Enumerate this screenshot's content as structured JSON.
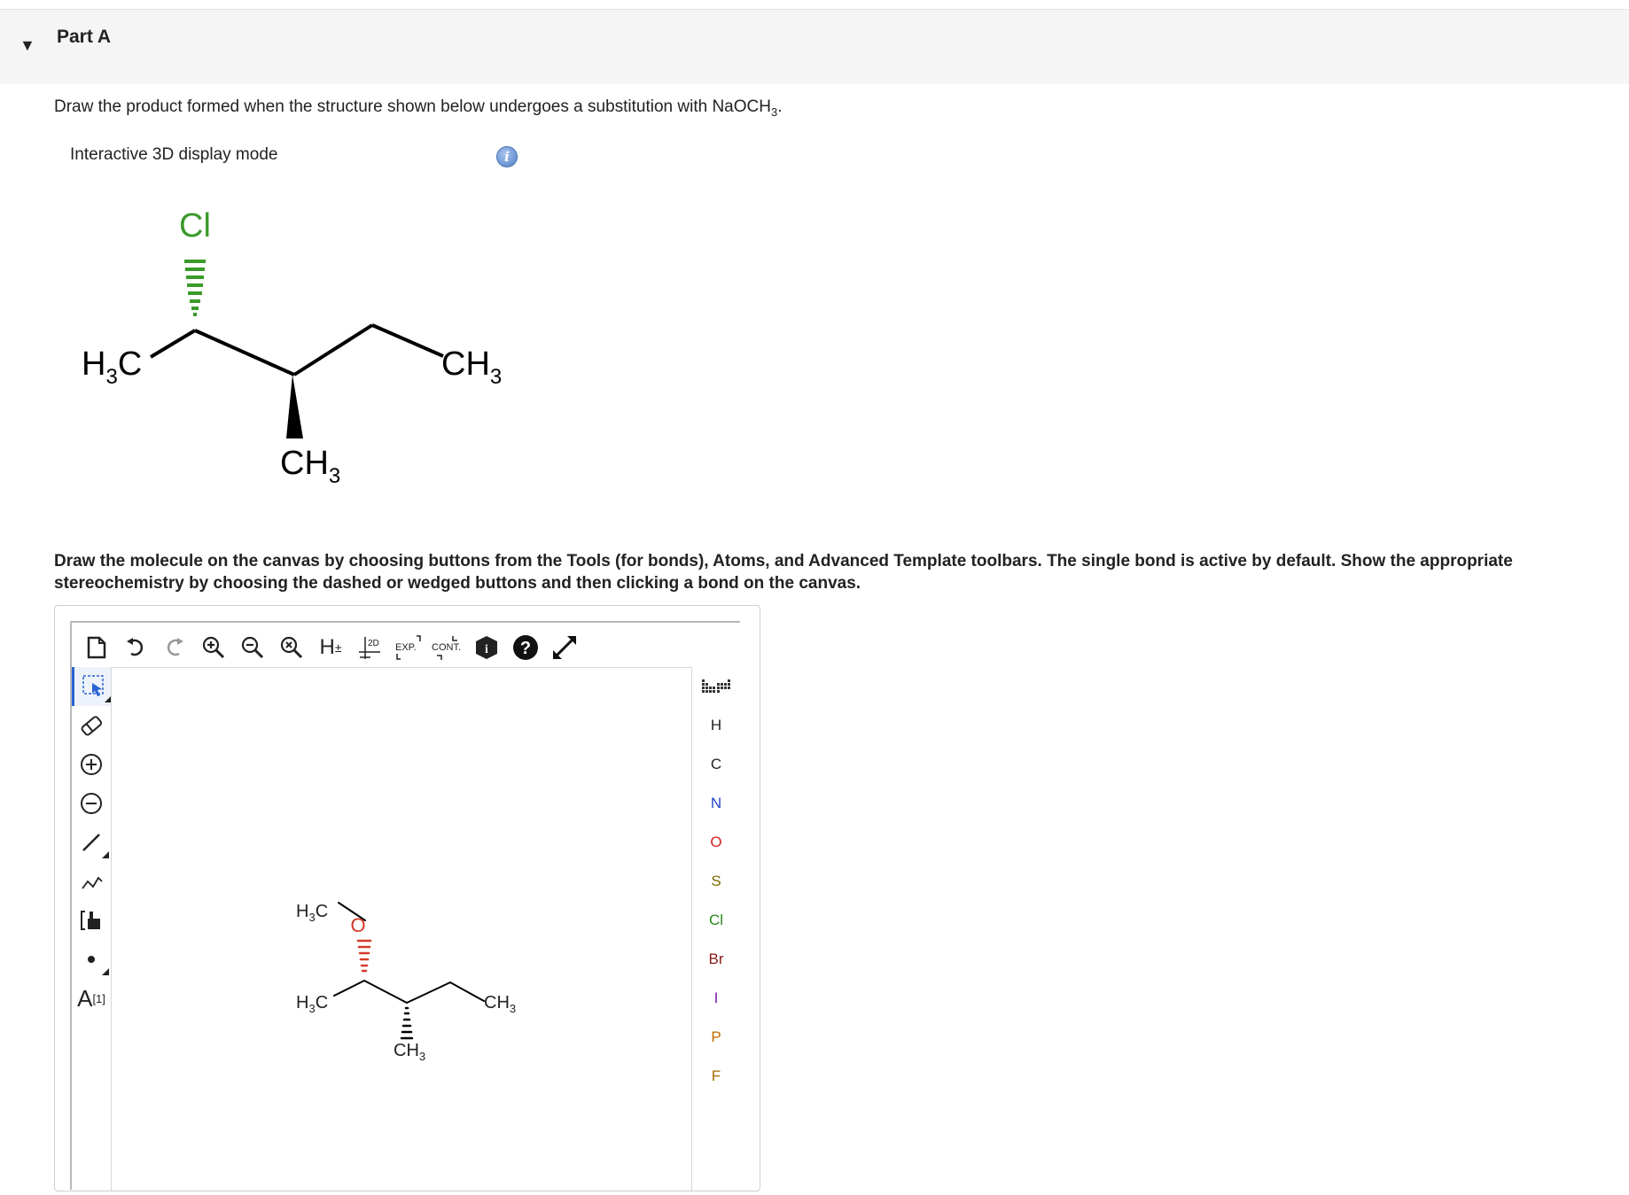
{
  "part": {
    "title": "Part A",
    "expanded": true
  },
  "question": {
    "text_before": "Draw the product formed when the structure shown below undergoes a substitution with NaOCH",
    "sub": "3",
    "text_after": "."
  },
  "display_mode": {
    "label": "Interactive 3D display mode",
    "info_glyph": "i"
  },
  "molecule_3d": {
    "labels": {
      "cl": "Cl",
      "h3c_left": "H3C",
      "ch3_right": "CH3",
      "ch3_bottom": "CH3"
    },
    "colors": {
      "cl": "#3a9a2a",
      "bond": "#000000"
    }
  },
  "instruction": "Draw the molecule on the canvas by choosing buttons from the Tools (for bonds), Atoms, and Advanced Template toolbars. The single bond is active by default. Show the appropriate stereochemistry by choosing the dashed or wedged buttons and then clicking a bond on the canvas.",
  "editor": {
    "top_toolbar": [
      {
        "name": "new-document-icon",
        "glyph": "🗋"
      },
      {
        "name": "undo-icon",
        "glyph": "↶"
      },
      {
        "name": "redo-icon",
        "glyph": "↷"
      },
      {
        "name": "zoom-in-icon",
        "glyph": "⊕"
      },
      {
        "name": "zoom-out-icon",
        "glyph": "⊖"
      },
      {
        "name": "zoom-reset-icon",
        "glyph": "⊗"
      },
      {
        "name": "hydrogen-toggle-icon",
        "glyph": "H±"
      },
      {
        "name": "clean-2d-icon",
        "glyph": "2D"
      },
      {
        "name": "expand-icon",
        "glyph": "EXP."
      },
      {
        "name": "contract-icon",
        "glyph": "CONT."
      },
      {
        "name": "about-icon",
        "glyph": "i"
      },
      {
        "name": "help-icon",
        "glyph": "?"
      },
      {
        "name": "fullscreen-icon",
        "glyph": "⤢"
      }
    ],
    "left_toolbar": [
      {
        "name": "select-tool-icon",
        "glyph": "⬚",
        "active": true
      },
      {
        "name": "erase-tool-icon",
        "glyph": "⌫"
      },
      {
        "name": "positive-charge-icon",
        "glyph": "⊕"
      },
      {
        "name": "negative-charge-icon",
        "glyph": "⊖"
      },
      {
        "name": "single-bond-icon",
        "glyph": "╱"
      },
      {
        "name": "chain-tool-icon",
        "glyph": "⩘"
      },
      {
        "name": "template-tool-icon",
        "glyph": "⌸"
      },
      {
        "name": "radical-tool-icon",
        "glyph": "•"
      },
      {
        "name": "atom-label-icon",
        "glyph": "A",
        "sup": "[1]"
      }
    ],
    "atoms": [
      {
        "symbol": "H",
        "color": "#222222"
      },
      {
        "symbol": "C",
        "color": "#222222"
      },
      {
        "symbol": "N",
        "color": "#2447c8"
      },
      {
        "symbol": "O",
        "color": "#d02020"
      },
      {
        "symbol": "S",
        "color": "#7a6a00"
      },
      {
        "symbol": "Cl",
        "color": "#2a8a1a"
      },
      {
        "symbol": "Br",
        "color": "#8a1a1a"
      },
      {
        "symbol": "I",
        "color": "#7a1ab0"
      },
      {
        "symbol": "P",
        "color": "#c06a00"
      },
      {
        "symbol": "F",
        "color": "#a06a00"
      }
    ],
    "canvas_molecule": {
      "labels": {
        "h3c_top": "H3C",
        "o": "O",
        "h3c_left": "H3C",
        "ch3_right": "CH3",
        "ch3_bottom": "CH3"
      },
      "colors": {
        "o": "#d63a2a",
        "bond": "#000000"
      }
    }
  }
}
